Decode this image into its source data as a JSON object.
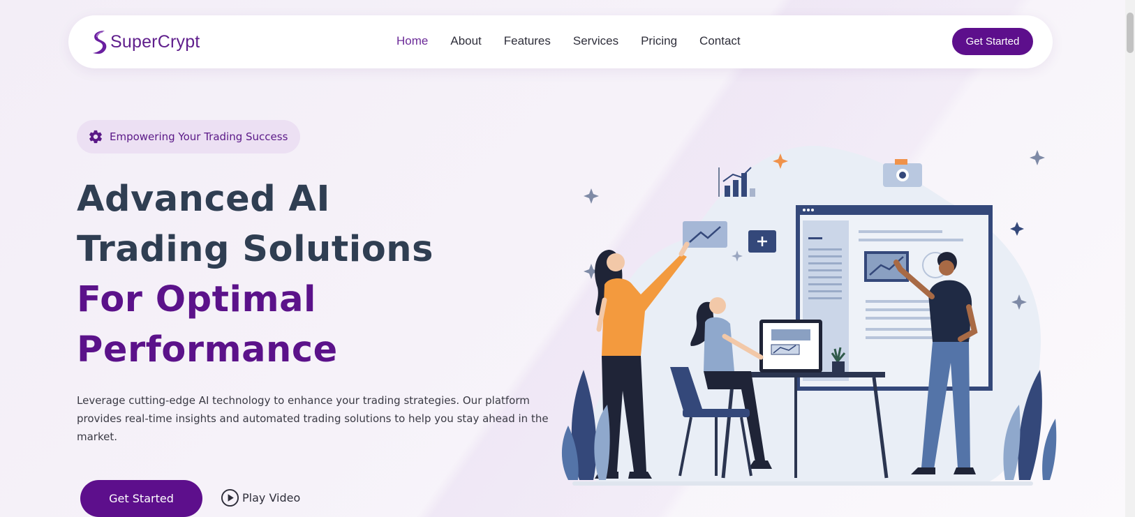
{
  "brand": {
    "name": "SuperCrypt",
    "color": "#5d0f8c"
  },
  "nav": {
    "items": [
      {
        "label": "Home",
        "active": true
      },
      {
        "label": "About",
        "active": false
      },
      {
        "label": "Features",
        "active": false
      },
      {
        "label": "Services",
        "active": false
      },
      {
        "label": "Pricing",
        "active": false
      },
      {
        "label": "Contact",
        "active": false
      }
    ],
    "cta_label": "Get Started"
  },
  "hero": {
    "badge_icon": "gear-icon",
    "badge_text": "Empowering Your Trading Success",
    "title_lines": [
      "Advanced AI",
      "Trading Solutions"
    ],
    "title_accent_lines": [
      "For Optimal",
      "Performance"
    ],
    "description": "Leverage cutting-edge AI technology to enhance your trading strategies. Our platform provides real-time insights and automated trading solutions to help you stay ahead in the market.",
    "primary_cta": "Get Started",
    "secondary_cta": "Play Video",
    "secondary_icon": "play-circle-icon"
  },
  "colors": {
    "accent": "#5d0f8c",
    "heading_dark": "#2f3e52",
    "heading_accent": "#5b128a",
    "badge_bg": "#ece0f3"
  }
}
